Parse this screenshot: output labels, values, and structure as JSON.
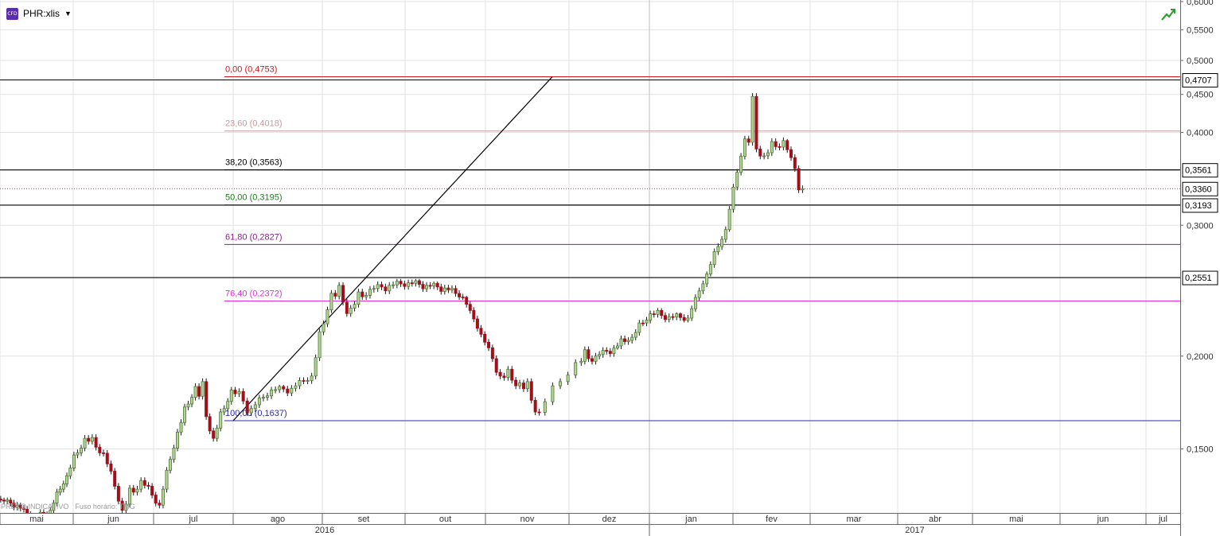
{
  "header": {
    "cfd_badge": "CFD",
    "ticker": "PHR:xlis",
    "dropdown_icon": "caret-down-icon",
    "chart_toggle_icon": "trend-chart-icon"
  },
  "footer": {
    "price_note": "PREÇO INDICATIVO",
    "timezone_note": "Fuso horário: TMG"
  },
  "colors": {
    "up_candle": "#5a8a3a",
    "down_candle": "#a0101a",
    "grid": "#e2e2e2",
    "fib_0": "#d4141a",
    "fib_23_6": "#c49b9b",
    "fib_38_2": "#000000",
    "fib_50": "#1f7a1f",
    "fib_61_8": "#8b1f8b",
    "fib_76_4": "#e02be0",
    "fib_100": "#2a2ab0"
  },
  "chart_data": {
    "type": "candlestick",
    "y_axis_ticks": [
      "0,6000",
      "0,5500",
      "0,5000",
      "0,4500",
      "0,4000",
      "0,3000",
      "0,2000",
      "0,1500"
    ],
    "y_axis_scale": "log",
    "ylim": [
      0.123,
      0.603
    ],
    "price_markers": [
      {
        "value": 0.4707,
        "label": "0,4707"
      },
      {
        "value": 0.3561,
        "label": "0,3561"
      },
      {
        "value": 0.336,
        "label": "0,3360"
      },
      {
        "value": 0.3193,
        "label": "0,3193"
      },
      {
        "value": 0.2551,
        "label": "0,2551"
      }
    ],
    "horizontal_lines": [
      0.4707,
      0.3561,
      0.3193,
      0.2551
    ],
    "last_price_dotted": 0.336,
    "fibonacci": {
      "levels": [
        {
          "value": 0.4753,
          "label": "0,00 (0,4753)",
          "color": "#d4141a"
        },
        {
          "value": 0.4018,
          "label": "23,60 (0,4018)",
          "color": "#c49b9b"
        },
        {
          "value": 0.3563,
          "label": "38,20 (0,3563)",
          "color": "#000000"
        },
        {
          "value": 0.3195,
          "label": "50,00 (0,3195)",
          "color": "#1f7a1f"
        },
        {
          "value": 0.2827,
          "label": "61,80 (0,2827)",
          "color": "#8b1f8b"
        },
        {
          "value": 0.2372,
          "label": "76,40 (0,2372)",
          "color": "#e02be0"
        },
        {
          "value": 0.1637,
          "label": "100,00 (0,1637)",
          "color": "#2a2ab0"
        }
      ],
      "start_date": "2016-08-01",
      "anchor_low": 0.1637,
      "anchor_high": 0.4753
    },
    "trendline": {
      "from": [
        "2016-08-01",
        0.1637
      ],
      "to": [
        "2016-11-25",
        0.4753
      ]
    },
    "x_axis": {
      "months": [
        "mai",
        "jun",
        "jul",
        "ago",
        "set",
        "out",
        "nov",
        "dez",
        "jan",
        "fev",
        "mar",
        "abr",
        "mai",
        "jun",
        "jul"
      ],
      "years": [
        "2016",
        "2017"
      ]
    },
    "ohlc_weekly_approx": [
      [
        "2016-04-11",
        0.131,
        0.133,
        0.128,
        0.132
      ],
      [
        "2016-04-18",
        0.132,
        0.134,
        0.13,
        0.133
      ],
      [
        "2016-04-25",
        0.133,
        0.134,
        0.127,
        0.128
      ],
      [
        "2016-05-02",
        0.128,
        0.129,
        0.124,
        0.126
      ],
      [
        "2016-05-09",
        0.126,
        0.127,
        0.118,
        0.12
      ],
      [
        "2016-05-16",
        0.12,
        0.126,
        0.117,
        0.124
      ],
      [
        "2016-05-23",
        0.124,
        0.14,
        0.123,
        0.138
      ],
      [
        "2016-05-30",
        0.138,
        0.158,
        0.136,
        0.155
      ],
      [
        "2016-06-06",
        0.155,
        0.159,
        0.146,
        0.148
      ],
      [
        "2016-06-13",
        0.148,
        0.15,
        0.122,
        0.124
      ],
      [
        "2016-06-20",
        0.124,
        0.141,
        0.122,
        0.136
      ],
      [
        "2016-06-27",
        0.136,
        0.138,
        0.124,
        0.126
      ],
      [
        "2016-07-04",
        0.126,
        0.16,
        0.124,
        0.158
      ],
      [
        "2016-07-11",
        0.158,
        0.186,
        0.156,
        0.182
      ],
      [
        "2016-07-18",
        0.182,
        0.199,
        0.152,
        0.155
      ],
      [
        "2016-07-25",
        0.155,
        0.184,
        0.153,
        0.18
      ],
      [
        "2016-08-01",
        0.18,
        0.184,
        0.163,
        0.17
      ],
      [
        "2016-08-08",
        0.17,
        0.182,
        0.168,
        0.18
      ],
      [
        "2016-08-15",
        0.18,
        0.183,
        0.176,
        0.181
      ],
      [
        "2016-08-22",
        0.181,
        0.19,
        0.179,
        0.188
      ],
      [
        "2016-08-29",
        0.188,
        0.25,
        0.186,
        0.243
      ],
      [
        "2016-09-05",
        0.243,
        0.256,
        0.222,
        0.232
      ],
      [
        "2016-09-12",
        0.232,
        0.254,
        0.229,
        0.246
      ],
      [
        "2016-09-19",
        0.246,
        0.252,
        0.24,
        0.249
      ],
      [
        "2016-09-26",
        0.249,
        0.254,
        0.245,
        0.251
      ],
      [
        "2016-10-03",
        0.251,
        0.254,
        0.244,
        0.249
      ],
      [
        "2016-10-10",
        0.249,
        0.252,
        0.242,
        0.247
      ],
      [
        "2016-10-17",
        0.247,
        0.25,
        0.238,
        0.24
      ],
      [
        "2016-10-24",
        0.24,
        0.241,
        0.212,
        0.214
      ],
      [
        "2016-10-31",
        0.214,
        0.216,
        0.183,
        0.188
      ],
      [
        "2016-11-07",
        0.188,
        0.195,
        0.18,
        0.184
      ],
      [
        "2016-11-14",
        0.184,
        0.193,
        0.163,
        0.168
      ],
      [
        "2016-11-21",
        0.168,
        0.2,
        0.165,
        0.196
      ],
      [
        "2016-12-05",
        0.196,
        0.208,
        0.192,
        0.2
      ],
      [
        "2016-12-12",
        0.2,
        0.207,
        0.196,
        0.205
      ],
      [
        "2016-12-19",
        0.205,
        0.216,
        0.204,
        0.212
      ],
      [
        "2016-12-26",
        0.212,
        0.232,
        0.21,
        0.228
      ],
      [
        "2017-01-02",
        0.228,
        0.232,
        0.222,
        0.226
      ],
      [
        "2017-01-09",
        0.226,
        0.229,
        0.222,
        0.225
      ],
      [
        "2017-01-16",
        0.225,
        0.26,
        0.223,
        0.258
      ],
      [
        "2017-01-23",
        0.258,
        0.3,
        0.256,
        0.296
      ],
      [
        "2017-01-30",
        0.296,
        0.396,
        0.294,
        0.392
      ],
      [
        "2017-02-06",
        0.392,
        0.471,
        0.365,
        0.372
      ],
      [
        "2017-02-13",
        0.372,
        0.402,
        0.365,
        0.39
      ],
      [
        "2017-02-20",
        0.39,
        0.392,
        0.316,
        0.336
      ]
    ]
  }
}
